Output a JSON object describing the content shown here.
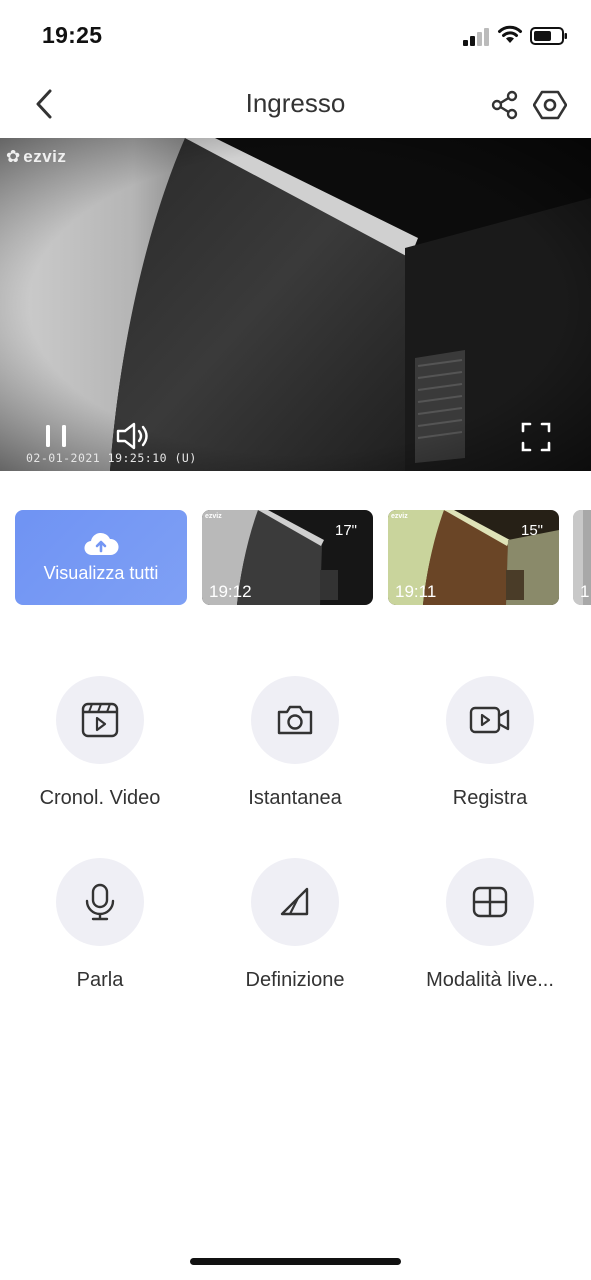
{
  "status_bar": {
    "time": "19:25",
    "signal_icon": "cellular-signal-icon",
    "wifi_icon": "wifi-icon",
    "battery_icon": "battery-icon"
  },
  "nav": {
    "title": "Ingresso",
    "back_icon": "chevron-left-icon",
    "share_icon": "share-icon",
    "settings_icon": "hexagon-settings-icon"
  },
  "video": {
    "brand": "ezviz",
    "timestamp": "02-01-2021 19:25:10 (U)",
    "pause_icon": "pause-icon",
    "volume_icon": "speaker-icon",
    "fullscreen_icon": "fullscreen-icon"
  },
  "clips": {
    "view_all_label": "Visualizza tutti",
    "view_all_icon": "cloud-upload-icon",
    "items": [
      {
        "time": "19:12",
        "duration": "17\""
      },
      {
        "time": "19:11",
        "duration": "15\""
      },
      {
        "time": "1",
        "duration": ""
      }
    ]
  },
  "controls": [
    {
      "label": "Cronol. Video",
      "icon": "video-history-icon"
    },
    {
      "label": "Istantanea",
      "icon": "camera-icon"
    },
    {
      "label": "Registra",
      "icon": "video-record-icon"
    },
    {
      "label": "Parla",
      "icon": "microphone-icon"
    },
    {
      "label": "Definizione",
      "icon": "definition-icon"
    },
    {
      "label": "Modalità live...",
      "icon": "grid-layout-icon"
    }
  ],
  "colors": {
    "accent": "#7396f4",
    "circle_bg": "#efeff5",
    "text": "#333333"
  }
}
